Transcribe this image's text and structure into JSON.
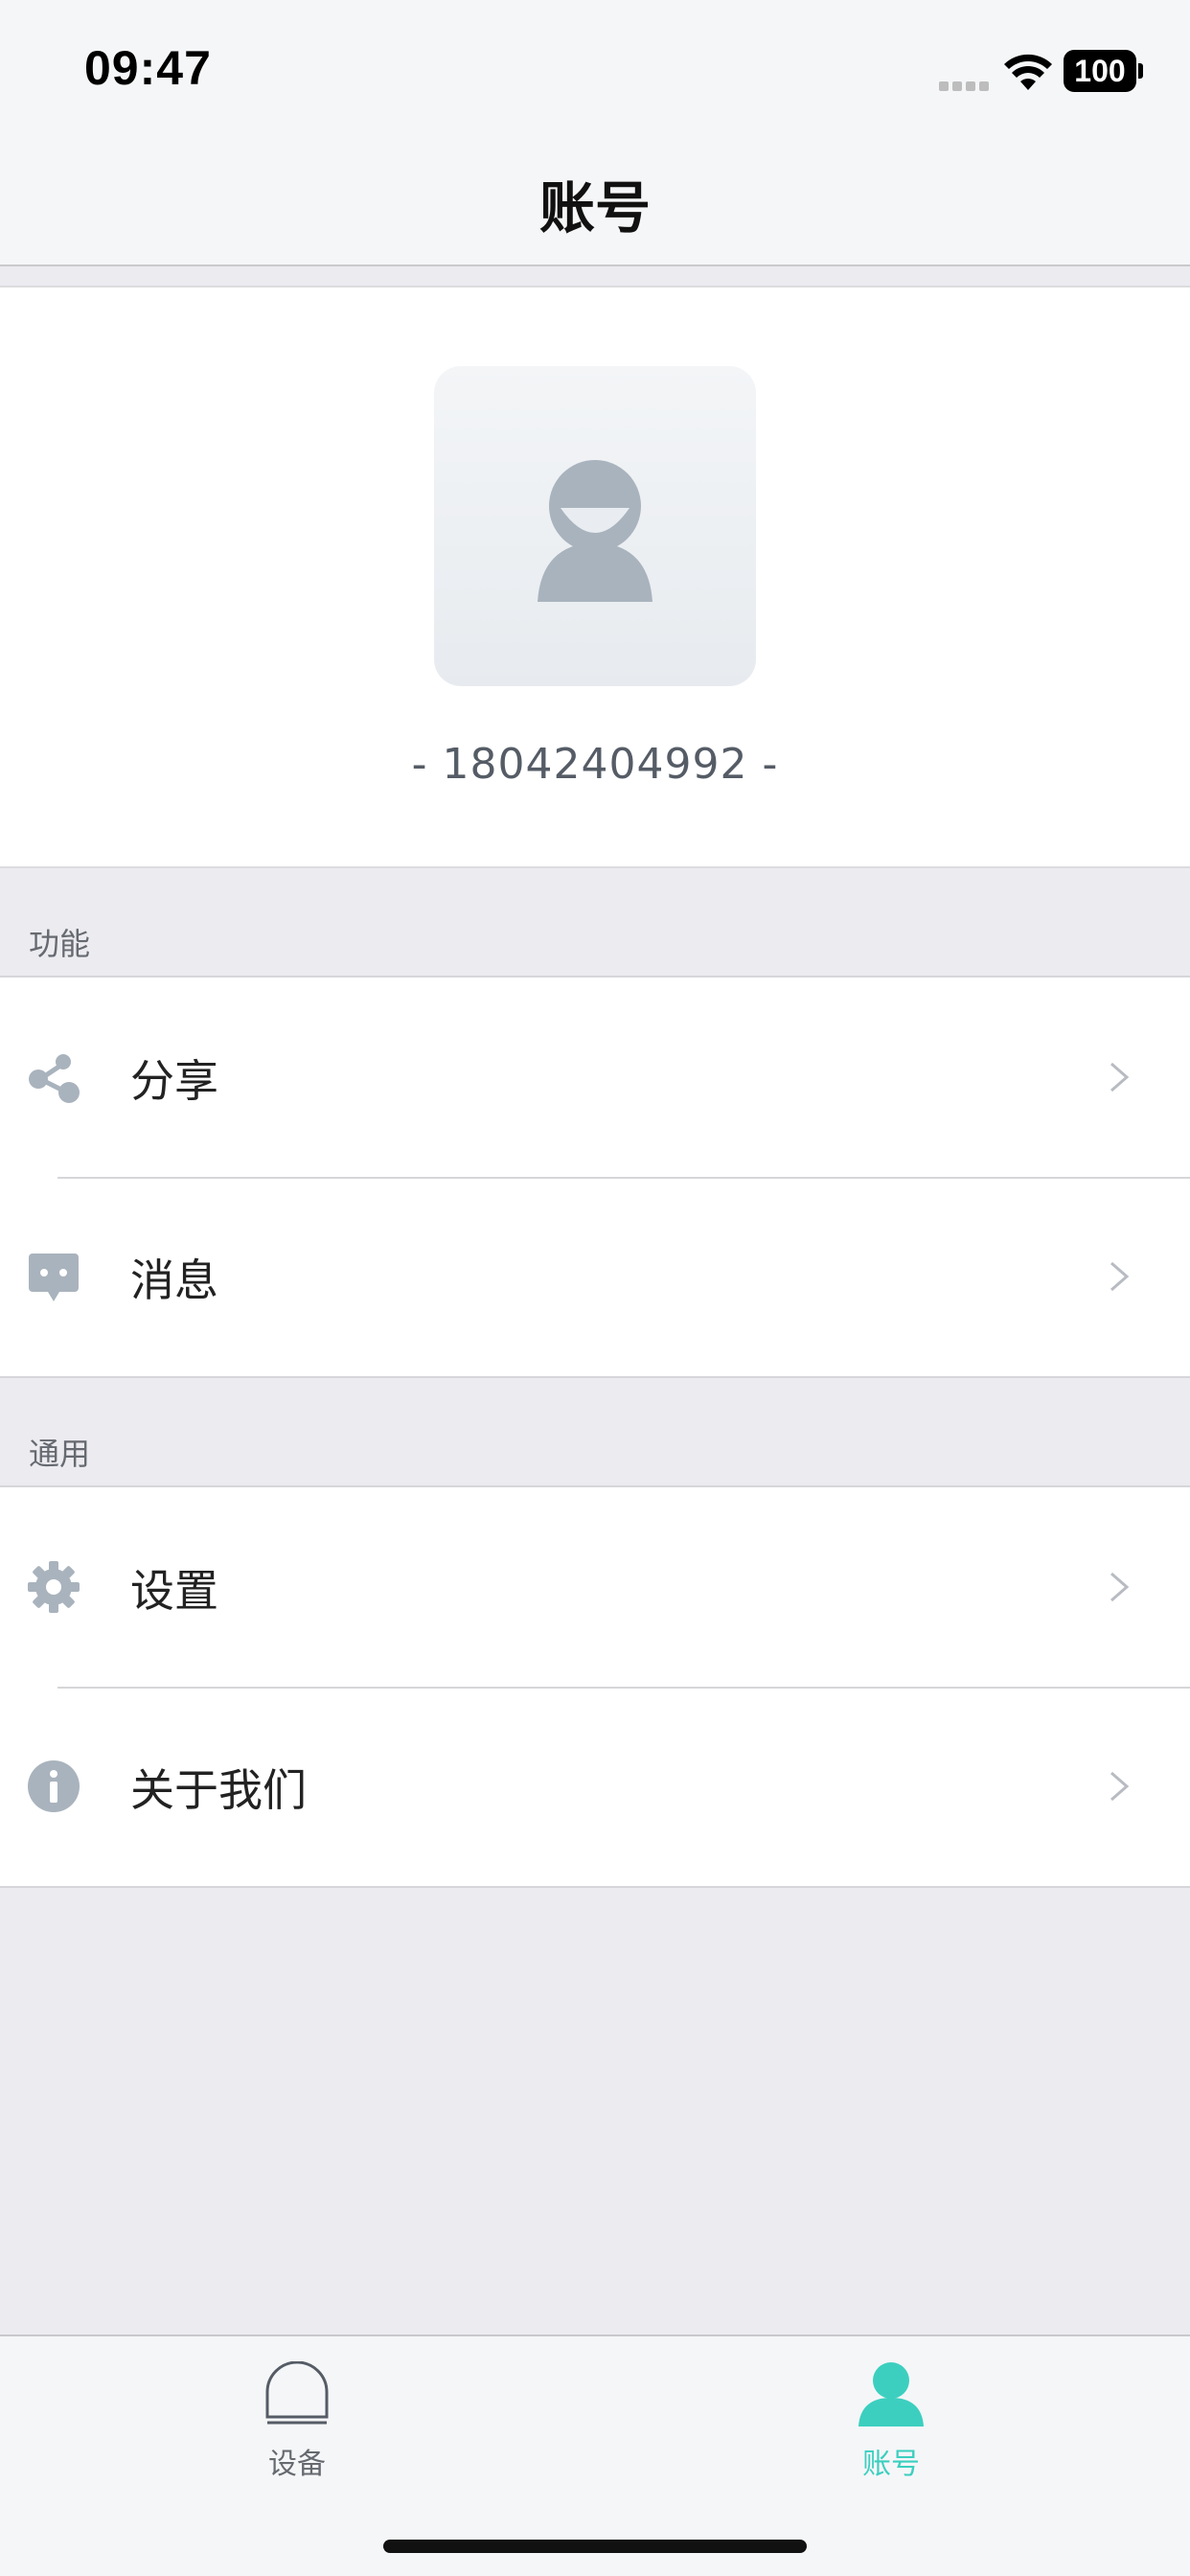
{
  "status_bar": {
    "time": "09:47",
    "battery": "100"
  },
  "nav": {
    "title": "账号"
  },
  "profile": {
    "phone": "- 18042404992 -"
  },
  "sections": [
    {
      "header": "功能",
      "items": [
        {
          "label": "分享",
          "icon": "share-icon"
        },
        {
          "label": "消息",
          "icon": "message-icon"
        }
      ]
    },
    {
      "header": "通用",
      "items": [
        {
          "label": "设置",
          "icon": "gear-icon"
        },
        {
          "label": "关于我们",
          "icon": "info-icon"
        }
      ]
    }
  ],
  "tabs": [
    {
      "label": "设备",
      "icon": "device-dome-icon",
      "active": false
    },
    {
      "label": "账号",
      "icon": "person-icon",
      "active": true
    }
  ],
  "colors": {
    "accent": "#3ccfbf",
    "icon_gray": "#a9b3bd",
    "background": "#ebebf0"
  }
}
